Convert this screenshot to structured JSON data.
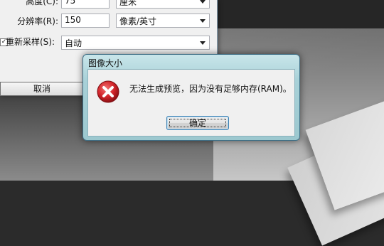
{
  "image_size_dialog": {
    "rows": [
      {
        "label": "高度(C):",
        "value": "75",
        "unit": "厘米"
      },
      {
        "label": "分辨率(R):",
        "value": "150",
        "unit": "像素/英寸"
      }
    ],
    "resample": {
      "label": "重新采样(S):",
      "checked": true,
      "value": "自动"
    },
    "cancel_label": "取消"
  },
  "error_dialog": {
    "title": "图像大小",
    "message": "无法生成预览，因为没有足够内存(RAM)。",
    "ok_label": "确定",
    "icon": "error-icon",
    "accent_color": "#d1242a"
  }
}
